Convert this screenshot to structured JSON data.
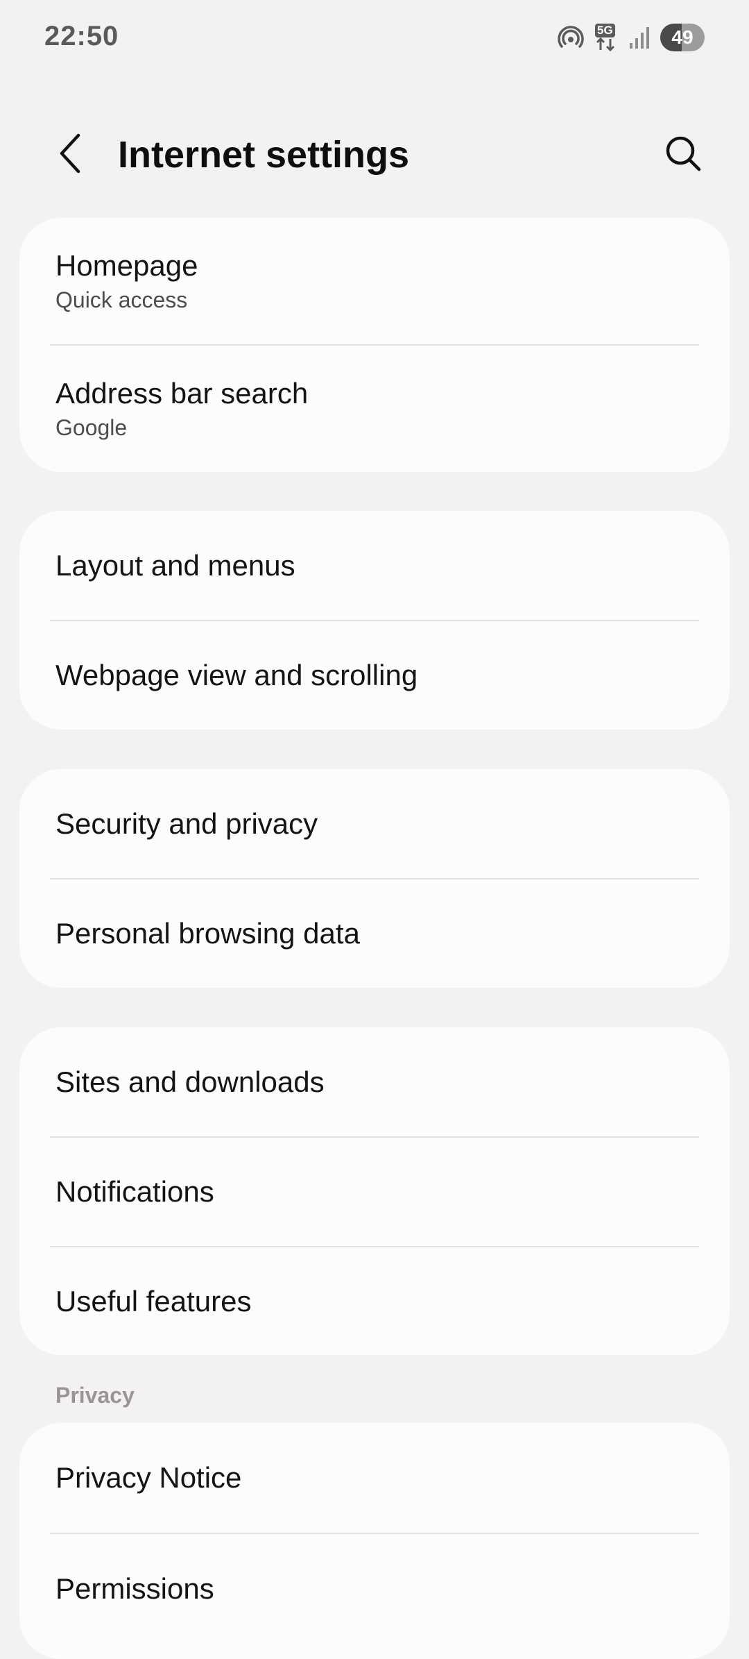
{
  "status_bar": {
    "time": "22:50",
    "network": "5G",
    "battery": "49",
    "battery_level": 0.49
  },
  "header": {
    "title": "Internet settings",
    "back_icon": "chevron-left-icon",
    "search_icon": "search-icon"
  },
  "groups": [
    {
      "items": [
        {
          "title": "Homepage",
          "subtitle": "Quick access"
        },
        {
          "title": "Address bar search",
          "subtitle": "Google"
        }
      ]
    },
    {
      "items": [
        {
          "title": "Layout and menus"
        },
        {
          "title": "Webpage view and scrolling"
        }
      ]
    },
    {
      "items": [
        {
          "title": "Security and privacy"
        },
        {
          "title": "Personal browsing data"
        }
      ]
    },
    {
      "items": [
        {
          "title": "Sites and downloads"
        },
        {
          "title": "Notifications"
        },
        {
          "title": "Useful features"
        }
      ]
    }
  ],
  "privacy_section": {
    "label": "Privacy",
    "items": [
      {
        "title": "Privacy Notice"
      },
      {
        "title": "Permissions"
      }
    ]
  },
  "colors": {
    "background": "#f3f1f1",
    "card": "#fdfcfd",
    "section_label": "#9b9496"
  }
}
